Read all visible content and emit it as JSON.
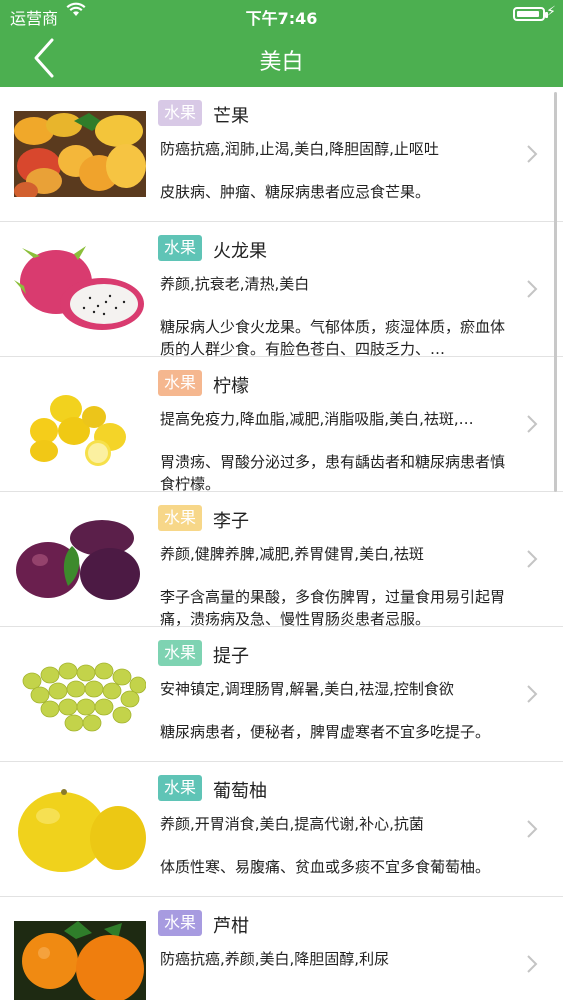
{
  "status": {
    "carrier": "运营商",
    "time": "下午7:46"
  },
  "nav": {
    "title": "美白"
  },
  "colors": {
    "header": "#4caf50"
  },
  "items": [
    {
      "tag": "水果",
      "tag_color": "#d8c9e6",
      "name": "芒果",
      "effects": "防癌抗癌,润肺,止渴,美白,降胆固醇,止呕吐",
      "note": "皮肤病、肿瘤、糖尿病患者应忌食芒果。",
      "image": "mango"
    },
    {
      "tag": "水果",
      "tag_color": "#5fc4b6",
      "name": "火龙果",
      "effects": "养颜,抗衰老,清热,美白",
      "note": "糖尿病人少食火龙果。气郁体质，痰湿体质，瘀血体质的人群少食。有脸色苍白、四肢乏力、…",
      "image": "dragonfruit"
    },
    {
      "tag": "水果",
      "tag_color": "#f5b78f",
      "name": "柠檬",
      "effects": "提高免疫力,降血脂,减肥,消脂吸脂,美白,祛斑,…",
      "note": "胃溃疡、胃酸分泌过多，患有龋齿者和糖尿病患者慎食柠檬。",
      "image": "lemon"
    },
    {
      "tag": "水果",
      "tag_color": "#f7d789",
      "name": "李子",
      "effects": "养颜,健脾养脾,减肥,养胃健胃,美白,祛斑",
      "note": "李子含高量的果酸，多食伤脾胃，过量食用易引起胃痛，溃疡病及急、慢性胃肠炎患者忌服。",
      "image": "plum"
    },
    {
      "tag": "水果",
      "tag_color": "#7ed3b2",
      "name": "提子",
      "effects": "安神镇定,调理肠胃,解暑,美白,祛湿,控制食欲",
      "note": "糖尿病患者，便秘者，脾胃虚寒者不宜多吃提子。",
      "image": "grape"
    },
    {
      "tag": "水果",
      "tag_color": "#5fc4b6",
      "name": "葡萄柚",
      "effects": "养颜,开胃消食,美白,提高代谢,补心,抗菌",
      "note": "体质性寒、易腹痛、贫血或多痰不宜多食葡萄柚。",
      "image": "grapefruit"
    },
    {
      "tag": "水果",
      "tag_color": "#a79be0",
      "name": "芦柑",
      "effects": "防癌抗癌,养颜,美白,降胆固醇,利尿",
      "note": "",
      "image": "orange"
    }
  ]
}
